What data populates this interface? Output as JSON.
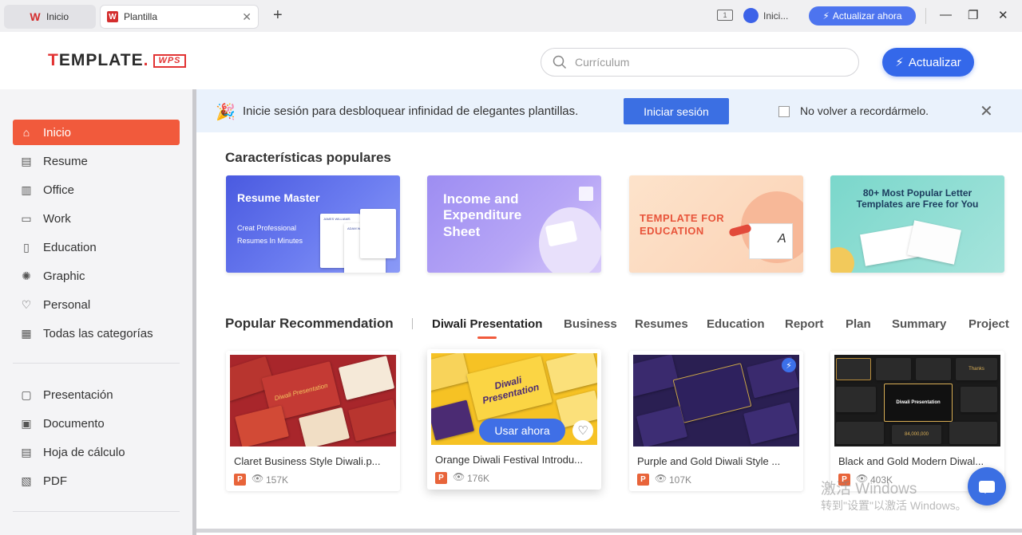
{
  "titlebar": {
    "tabs": [
      {
        "label": "Inicio",
        "icon": "wps-logo-icon"
      },
      {
        "label": "Plantilla",
        "icon": "wps-logo-icon",
        "close": "✕"
      }
    ],
    "new_tab": "+",
    "window_badge": "1",
    "user_label": "Inici...",
    "upgrade_label": "Actualizar ahora",
    "controls": {
      "minimize": "—",
      "maximize": "❐",
      "close": "✕"
    }
  },
  "header": {
    "brand_prefix": "T",
    "brand_rest": "EMPLATE",
    "brand_dot": ".",
    "brand_badge": "WPS",
    "search_placeholder": "Currículum",
    "upgrade_label": "Actualizar"
  },
  "sidebar": {
    "items": [
      {
        "label": "Inicio",
        "icon": "home-icon",
        "glyph": "⌂"
      },
      {
        "label": "Resume",
        "icon": "resume-icon",
        "glyph": "▤"
      },
      {
        "label": "Office",
        "icon": "office-icon",
        "glyph": "▥"
      },
      {
        "label": "Work",
        "icon": "briefcase-icon",
        "glyph": "▭"
      },
      {
        "label": "Education",
        "icon": "book-icon",
        "glyph": "▯"
      },
      {
        "label": "Graphic",
        "icon": "bulb-icon",
        "glyph": "✺"
      },
      {
        "label": "Personal",
        "icon": "heart-icon",
        "glyph": "♡"
      },
      {
        "label": "Todas las categorías",
        "icon": "grid-icon",
        "glyph": "▦"
      }
    ],
    "apps": [
      {
        "label": "Presentación",
        "icon": "presentation-icon",
        "glyph": "▢"
      },
      {
        "label": "Documento",
        "icon": "document-icon",
        "glyph": "▣"
      },
      {
        "label": "Hoja de cálculo",
        "icon": "spreadsheet-icon",
        "glyph": "▤"
      },
      {
        "label": "PDF",
        "icon": "pdf-icon",
        "glyph": "▧"
      }
    ]
  },
  "banner": {
    "message": "Inicie sesión para desbloquear infinidad de elegantes plantillas.",
    "login_label": "Iniciar sesión",
    "dont_remind_label": "No volver a recordármelo.",
    "close": "✕"
  },
  "features": {
    "title": "Características populares",
    "cards": [
      {
        "title": "Resume Master",
        "subtitle_1": "Creat Professional",
        "subtitle_2": "Resumes In Minutes",
        "paper_label_1": "JAMES WILLIAMS",
        "paper_label_2": "ADAM WILSON"
      },
      {
        "title": "Income and Expenditure Sheet"
      },
      {
        "title": "TEMPLATE FOR EDUCATION",
        "glyph": "A"
      },
      {
        "title": "80+ Most Popular Letter Templates are Free for You"
      }
    ]
  },
  "recommendation": {
    "title": "Popular Recommendation",
    "tabs": [
      "Diwali Presentation",
      "Business",
      "Resumes",
      "Education",
      "Report",
      "Plan",
      "Summary",
      "Project"
    ],
    "active_tab": 0,
    "cards": [
      {
        "title": "Claret Business Style Diwali.p...",
        "views": "157K",
        "thumb_text": "Diwali Presentation"
      },
      {
        "title": "Orange Diwali Festival Introdu...",
        "views": "176K",
        "thumb_text": "Diwali Presentation",
        "use_label": "Usar ahora"
      },
      {
        "title": "Purple and Gold Diwali Style ...",
        "views": "107K"
      },
      {
        "title": "Black and Gold Modern Diwal...",
        "views": "403K",
        "thumb_text": "Diwali Presentation",
        "thumb_label_2": "Thanks",
        "thumb_number": "84,000,000"
      }
    ]
  },
  "watermark": {
    "line1": "激活 Windows",
    "line2": "转到\"设置\"以激活 Windows。"
  },
  "colors": {
    "accent": "#f15a3c",
    "primary": "#3b6fe3",
    "banner_bg": "#eaf2fc",
    "sidebar_bg": "#f4f4f6"
  }
}
